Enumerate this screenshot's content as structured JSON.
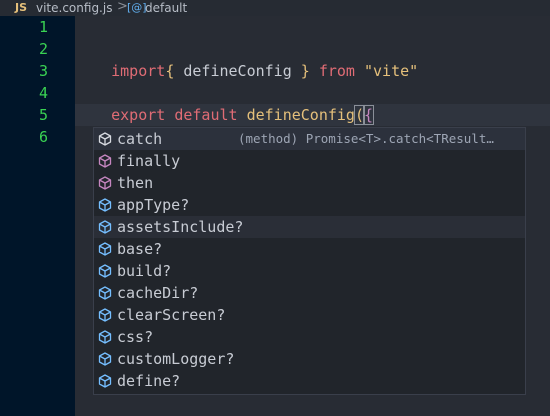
{
  "breadcrumb": {
    "lang_badge": "JS",
    "file": "vite.config.js",
    "separator": ">",
    "symbol_icon": "[@]",
    "symbol": "default"
  },
  "gutter": {
    "line_numbers": [
      "1",
      "2",
      "3",
      "4",
      "5",
      "6"
    ]
  },
  "code": {
    "line2": {
      "import": "import",
      "open": "{",
      "name": " defineConfig ",
      "close": "}",
      "from": " from ",
      "module": "\"vite\""
    },
    "line4": {
      "export": "export",
      "default": " default ",
      "call": "defineConfig",
      "paren": "(",
      "brace": "{"
    },
    "line6": {
      "brace": "}",
      "paren": ")"
    }
  },
  "suggest": {
    "items": [
      {
        "label": "catch",
        "kind": "method-icon",
        "detail": "(method) Promise<T>.catch<TResult…"
      },
      {
        "label": "finally",
        "kind": "method-icon"
      },
      {
        "label": "then",
        "kind": "method-icon"
      },
      {
        "label": "appType?",
        "kind": "property-icon"
      },
      {
        "label": "assetsInclude?",
        "kind": "property-icon"
      },
      {
        "label": "base?",
        "kind": "property-icon"
      },
      {
        "label": "build?",
        "kind": "property-icon"
      },
      {
        "label": "cacheDir?",
        "kind": "property-icon"
      },
      {
        "label": "clearScreen?",
        "kind": "property-icon"
      },
      {
        "label": "css?",
        "kind": "property-icon"
      },
      {
        "label": "customLogger?",
        "kind": "property-icon"
      },
      {
        "label": "define?",
        "kind": "property-icon"
      }
    ]
  },
  "colors": {
    "keyword": "#e06c75",
    "string": "#e5c07b",
    "line_number": "#39d353",
    "method_icon": "#c586c0",
    "property_icon": "#75beff"
  }
}
